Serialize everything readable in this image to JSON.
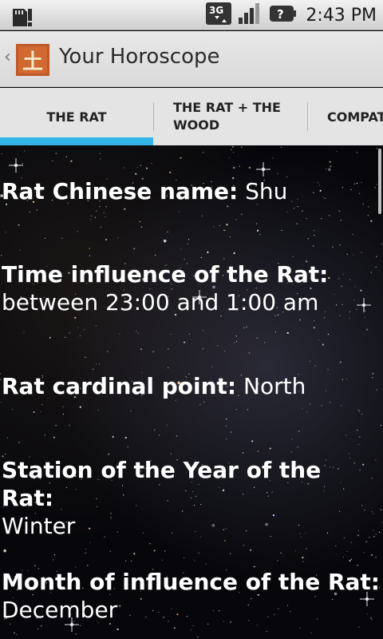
{
  "status_bar": {
    "time": "2:43 PM",
    "network": "3G"
  },
  "app_bar": {
    "back_glyph": "‹",
    "title": "Your Horoscope",
    "icon_glyph": "土"
  },
  "tabs": [
    {
      "label": "THE RAT",
      "selected": true
    },
    {
      "label": "THE RAT + THE WOOD",
      "selected": false
    },
    {
      "label": "COMPAT",
      "selected": false
    }
  ],
  "accent_color": "#33b5e5",
  "info": [
    {
      "label": "Rat Chinese name:",
      "value": "Shu"
    },
    {
      "label": "Time influence of the Rat:",
      "value": "between 23:00 and 1:00 am"
    },
    {
      "label": "Rat cardinal point:",
      "value": "North"
    },
    {
      "label": "Station of the Year of the Rat:",
      "value": "Winter"
    },
    {
      "label": "Month of influence of the Rat:",
      "value": "December"
    }
  ]
}
